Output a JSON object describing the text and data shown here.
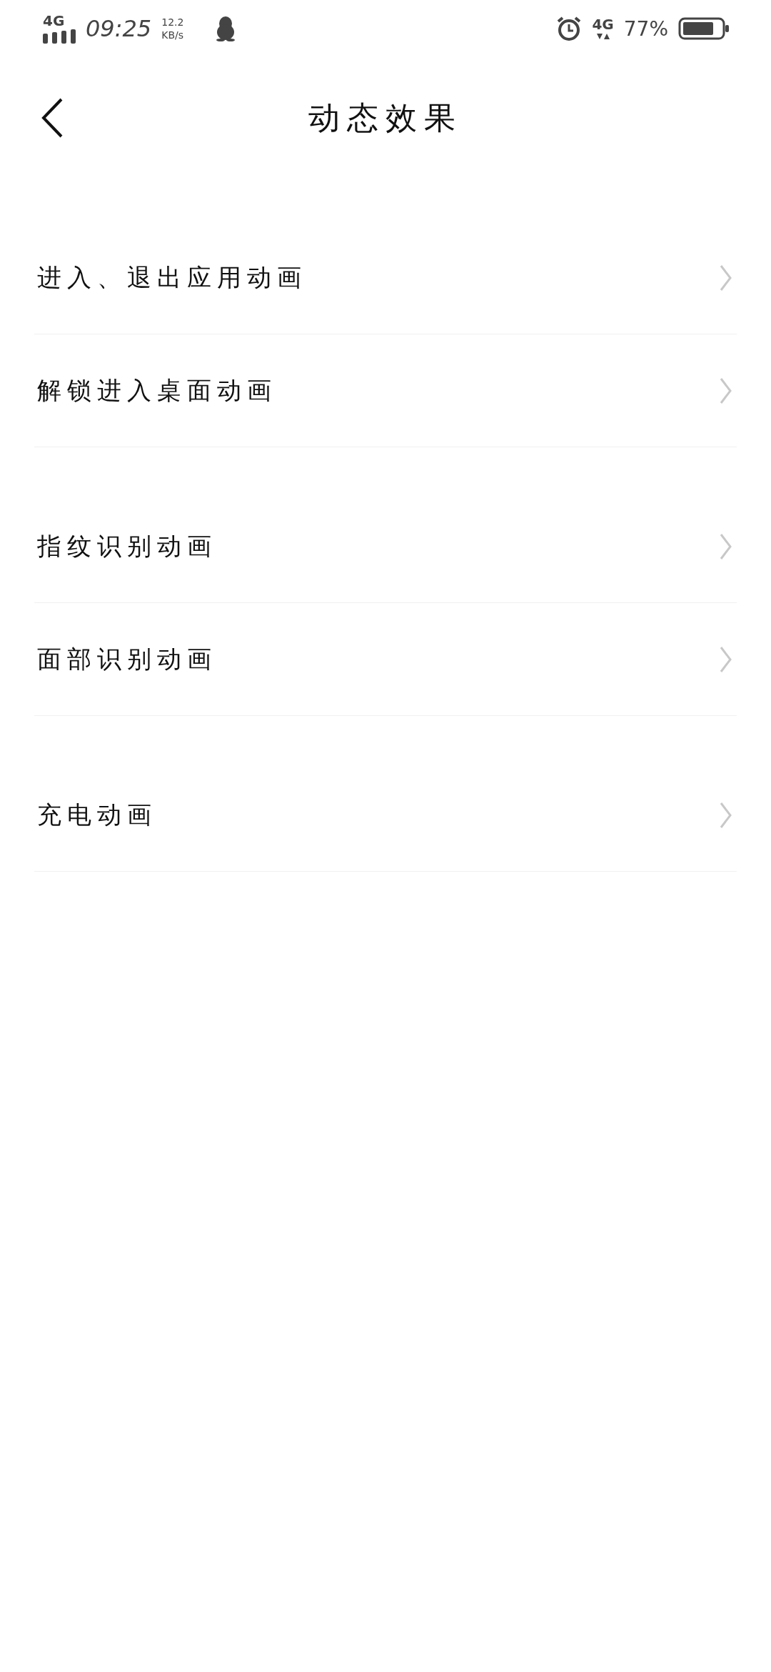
{
  "status_bar": {
    "network": "4G",
    "time": "09:25",
    "speed": "12.2",
    "speed_unit": "KB/s",
    "network_right": "4G",
    "battery": "77%"
  },
  "header": {
    "title": "动态效果"
  },
  "groups": [
    {
      "items": [
        {
          "label": "进入、退出应用动画"
        },
        {
          "label": "解锁进入桌面动画"
        }
      ]
    },
    {
      "items": [
        {
          "label": "指纹识别动画"
        },
        {
          "label": "面部识别动画"
        }
      ]
    },
    {
      "items": [
        {
          "label": "充电动画"
        }
      ]
    }
  ]
}
